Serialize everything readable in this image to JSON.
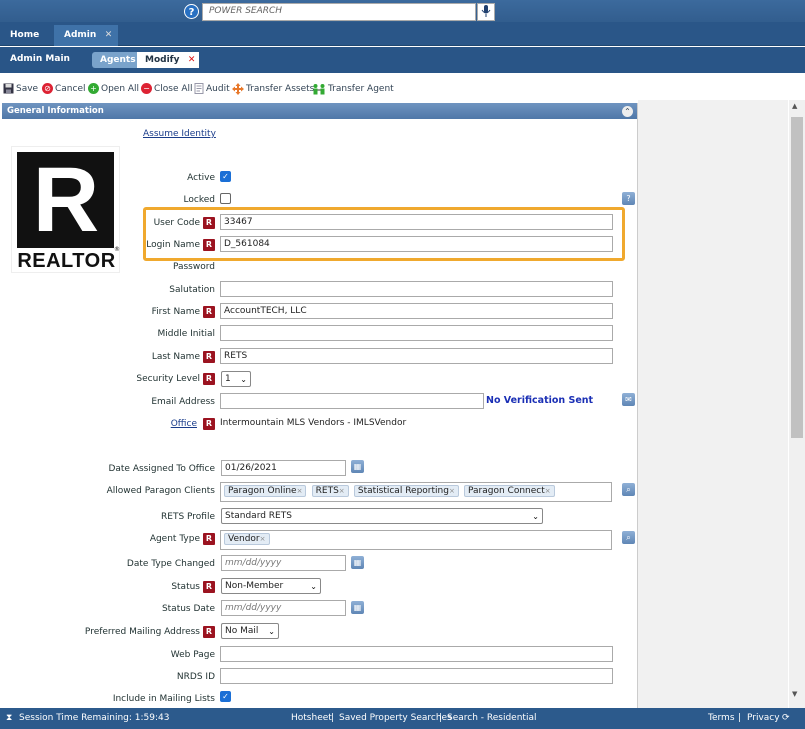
{
  "search": {
    "placeholder": "POWER SEARCH",
    "help": "?"
  },
  "nav": {
    "home": "Home",
    "admin": "Admin",
    "close": "✕"
  },
  "subnav": {
    "title": "Admin Main",
    "agents": "Agents",
    "modify": "Modify",
    "close": "✕"
  },
  "toolbar": {
    "save": "Save",
    "cancel": "Cancel",
    "open_all": "Open All",
    "close_all": "Close All",
    "audit": "Audit",
    "transfer_assets": "Transfer Assets",
    "transfer_agent": "Transfer Agent"
  },
  "section": {
    "title": "General Information"
  },
  "logo": {
    "letter": "R",
    "text": "REALTOR",
    "reg": "®"
  },
  "assume_identity": "Assume Identity",
  "required_mark": "R",
  "help_mark": "?",
  "fields": {
    "active": "Active",
    "locked": "Locked",
    "user_code": "User Code",
    "user_code_value": "33467",
    "login_name": "Login Name",
    "login_name_value": "D_561084",
    "password": "Password",
    "salutation": "Salutation",
    "first_name": "First Name",
    "first_name_value": "AccountTECH, LLC",
    "middle_initial": "Middle Initial",
    "last_name": "Last Name",
    "last_name_value": "RETS",
    "security_level": "Security Level",
    "security_level_value": "1",
    "email": "Email Address",
    "no_verification": "No Verification Sent",
    "office": "Office",
    "office_value": "Intermountain MLS Vendors - IMLSVendor",
    "date_assigned": "Date Assigned To Office",
    "date_assigned_value": "01/26/2021",
    "allowed_clients": "Allowed Paragon Clients",
    "client_tags": [
      "Paragon Online",
      "RETS",
      "Statistical Reporting",
      "Paragon Connect"
    ],
    "rets_profile": "RETS Profile",
    "rets_profile_value": "Standard RETS",
    "agent_type": "Agent Type",
    "agent_type_tag": "Vendor",
    "date_type_changed": "Date Type Changed",
    "date_placeholder": "mm/dd/yyyy",
    "status": "Status",
    "status_value": "Non-Member",
    "status_date": "Status Date",
    "preferred_mailing": "Preferred Mailing Address",
    "preferred_mailing_value": "No Mail",
    "web_page": "Web Page",
    "nrds_id": "NRDS ID",
    "include_mailing": "Include in Mailing Lists",
    "tag_remove": "×"
  },
  "statusbar": {
    "session": "Session Time Remaining: 1:59:43",
    "hotsheet": "Hotsheet",
    "saved_searches": "Saved Property Searches",
    "search_residential": "Search - Residential",
    "terms": "Terms",
    "privacy": "Privacy",
    "sep": "|"
  },
  "colors": {
    "accent": "#2a5688",
    "required": "#9b1320",
    "highlight": "#f0a92e",
    "link": "#1a3c8a"
  }
}
